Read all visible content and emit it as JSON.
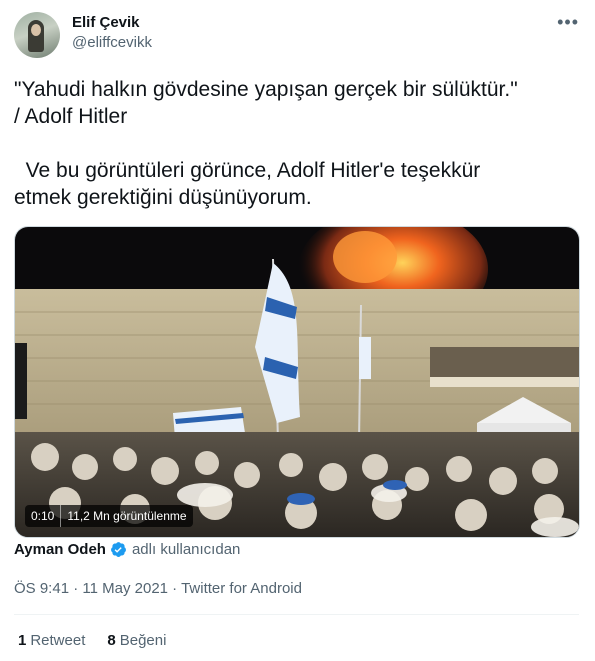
{
  "author": {
    "name": "Elif Çevik",
    "handle": "@eliffcevikk"
  },
  "more_label": "•••",
  "tweet_text": "\"Yahudi halkın gövdesine yapışan gerçek bir sülüktür.\"\n/ Adolf Hitler\n\n  Ve bu görüntüleri görünce, Adolf Hitler'e teşekkür\netmek gerektiğini düşünüyorum.",
  "media": {
    "duration": "0:10",
    "views": "11,2 Mn görüntülenme"
  },
  "attribution": {
    "source_name": "Ayman Odeh",
    "suffix": "adlı kullanıcıdan",
    "verified_color": "#1d9bf0"
  },
  "meta": {
    "time": "ÖS 9:41",
    "date": "11 May 2021",
    "client": "Twitter for Android",
    "separator": " · "
  },
  "stats": {
    "retweets_count": "1",
    "retweets_label": "Retweet",
    "likes_count": "8",
    "likes_label": "Beğeni"
  }
}
